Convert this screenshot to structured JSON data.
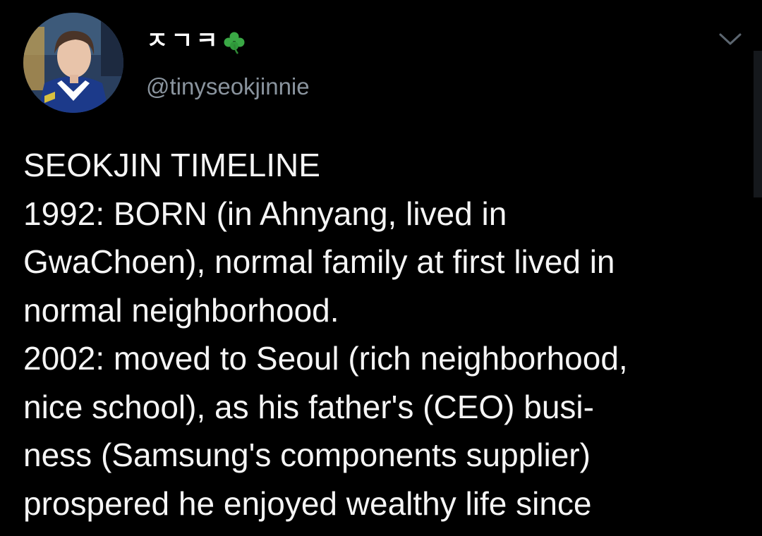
{
  "tweet": {
    "display_name": "ㅈㄱㅋ",
    "display_name_emoji": "clover-icon",
    "handle": "@tinyseokjinnie",
    "menu_icon": "chevron-down-icon",
    "lines": [
      "SEOKJIN TIMELINE",
      "1992: BORN (in Ahnyang, lived in",
      "GwaChoen), normal family at first lived in",
      "normal neighborhood.",
      "2002: moved to Seoul (rich neighborhood,",
      "nice school), as his father's (CEO) busi-",
      "ness (Samsung's components supplier)",
      "prospered he enjoyed wealthy life since"
    ]
  },
  "colors": {
    "background": "#000000",
    "text": "#f5f5f5",
    "handle": "#8a949e",
    "chevron": "#5c6670",
    "clover": "#3aa845"
  }
}
